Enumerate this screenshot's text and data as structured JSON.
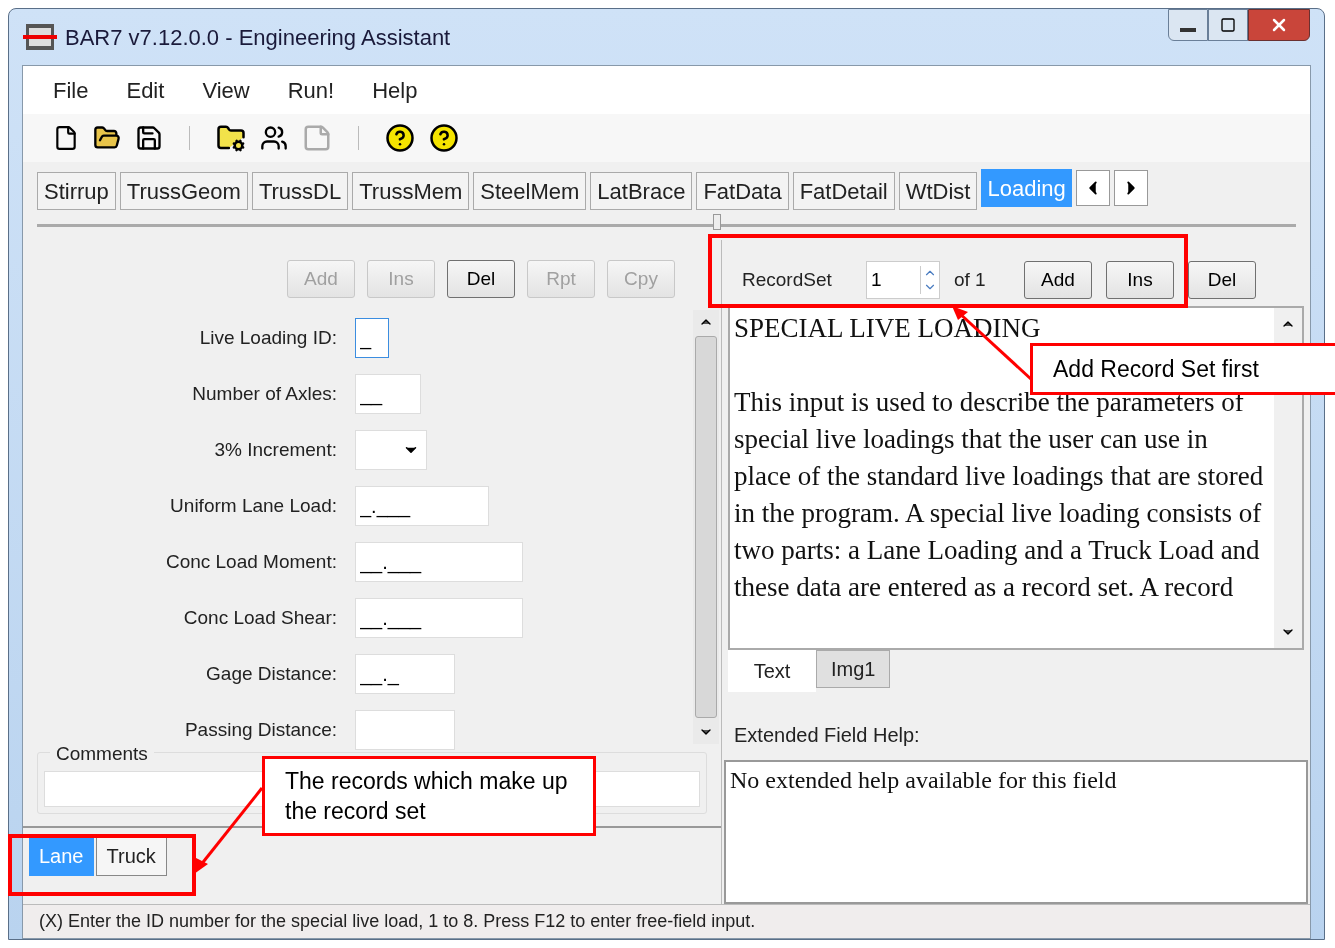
{
  "window": {
    "title": "BAR7 v7.12.0.0 - Engineering Assistant"
  },
  "menu": [
    "File",
    "Edit",
    "View",
    "Run!",
    "Help"
  ],
  "tabs": [
    {
      "label": "Stirrup",
      "selected": false
    },
    {
      "label": "TrussGeom",
      "selected": false
    },
    {
      "label": "TrussDL",
      "selected": false
    },
    {
      "label": "TrussMem",
      "selected": false
    },
    {
      "label": "SteelMem",
      "selected": false
    },
    {
      "label": "LatBrace",
      "selected": false
    },
    {
      "label": "FatData",
      "selected": false
    },
    {
      "label": "FatDetail",
      "selected": false
    },
    {
      "label": "WtDist",
      "selected": false
    },
    {
      "label": "Loading",
      "selected": true
    }
  ],
  "record_buttons": [
    {
      "label": "Add",
      "disabled": true
    },
    {
      "label": "Ins",
      "disabled": true
    },
    {
      "label": "Del",
      "disabled": false
    },
    {
      "label": "Rpt",
      "disabled": true
    },
    {
      "label": "Cpy",
      "disabled": true
    }
  ],
  "fields": [
    {
      "label": "Live Loading ID:",
      "kind": "text",
      "value": "_",
      "focused": true
    },
    {
      "label": "Number of Axles:",
      "kind": "text",
      "value": "__",
      "focused": false
    },
    {
      "label": "3% Increment:",
      "kind": "dropdown",
      "focused": false
    },
    {
      "label": "Uniform Lane Load:",
      "kind": "text",
      "value": "_.___",
      "focused": false
    },
    {
      "label": "Conc Load Moment:",
      "kind": "text",
      "value": "__.___",
      "focused": false
    },
    {
      "label": "Conc Load Shear:",
      "kind": "text",
      "value": "__.___",
      "focused": false
    },
    {
      "label": "Gage Distance:",
      "kind": "text",
      "value": "__._",
      "focused": false
    },
    {
      "label": "Passing Distance:",
      "kind": "text",
      "focused": false
    }
  ],
  "comments": {
    "label": "Comments"
  },
  "record_tabs": [
    {
      "label": "Lane",
      "selected": true
    },
    {
      "label": "Truck",
      "selected": false
    }
  ],
  "recordset": {
    "label": "RecordSet",
    "value": "1",
    "of": "of 1",
    "buttons": [
      "Add",
      "Ins",
      "Del"
    ]
  },
  "help": {
    "title": "SPECIAL LIVE LOADING",
    "text": "This input is used to describe the parameters of special live loadings that the user can use in place of the standard live loadings that are stored in the program.  A special live loading consists of two parts: a Lane Loading and a Truck Load and these data are entered as a record set.  A record"
  },
  "help_tabs": [
    {
      "label": "Text",
      "selected": true
    },
    {
      "label": "Img1",
      "selected": false
    }
  ],
  "extended_help": {
    "label": "Extended Field Help:",
    "text": "No extended help available for this field"
  },
  "status_bar": "(X) Enter the ID number for the special live load, 1 to 8. Press F12 to enter free-field input.",
  "callouts": [
    "Add Record Set first",
    "The records which make up the record set"
  ]
}
